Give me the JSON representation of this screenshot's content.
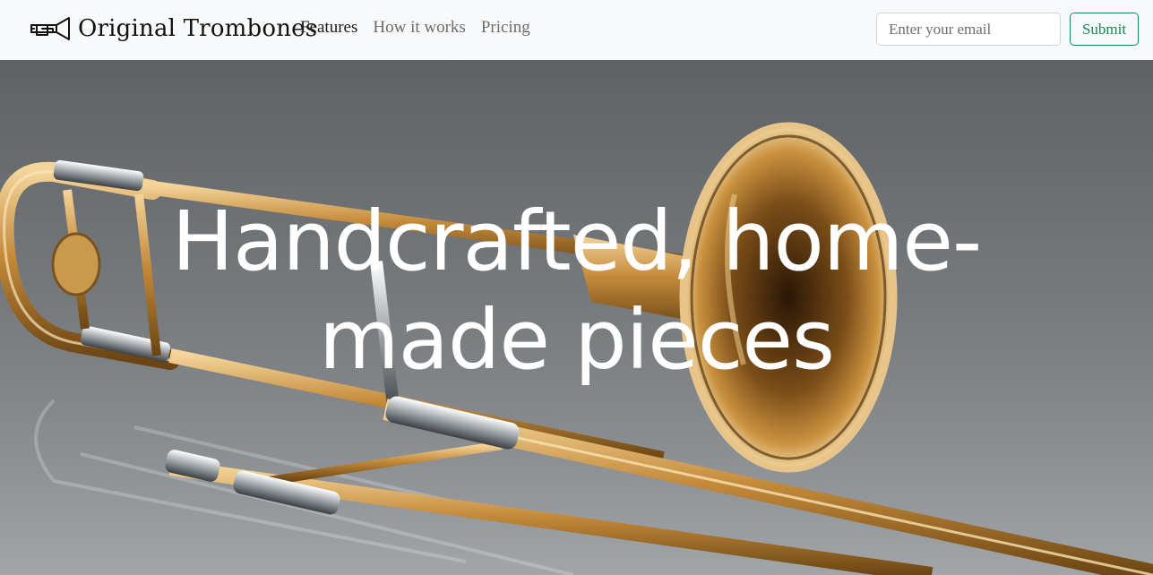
{
  "brand": {
    "name": "Original Trombones",
    "logo_icon": "trombone-icon"
  },
  "nav": {
    "links": [
      {
        "label": "Features",
        "active": true
      },
      {
        "label": "How it works",
        "active": false
      },
      {
        "label": "Pricing",
        "active": false
      }
    ]
  },
  "signup": {
    "email_placeholder": "Enter your email",
    "email_value": "",
    "submit_label": "Submit"
  },
  "hero": {
    "title_line1": "Handcrafted, home-",
    "title_line2": "made pieces",
    "image": "trombone-photo"
  },
  "colors": {
    "navbar_bg": "#f8f9fa",
    "accent_green": "#198754",
    "hero_text": "#ffffff"
  }
}
